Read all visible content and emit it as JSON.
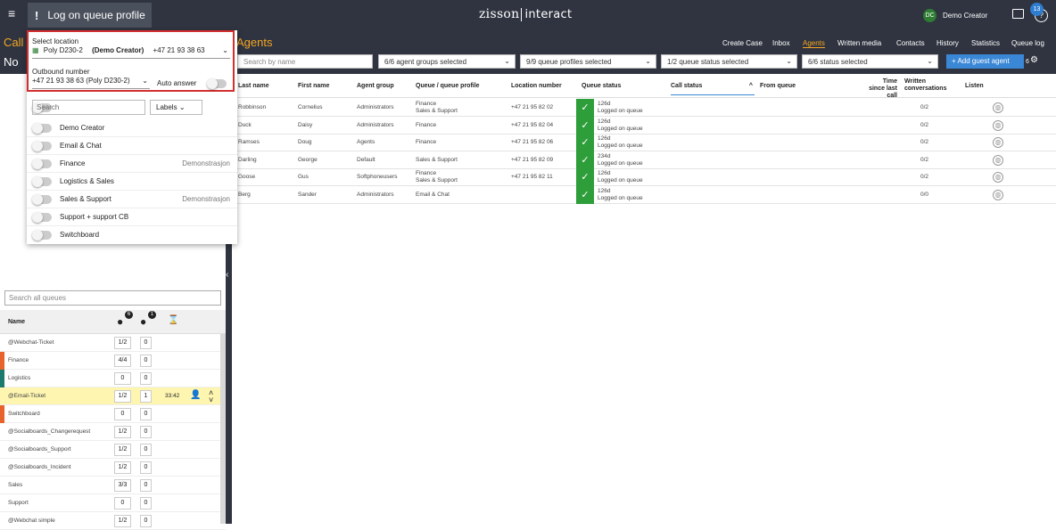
{
  "topbar": {
    "menu_icon": "hamburger-icon",
    "button_label": "Log on queue profile",
    "button_excl": "!",
    "logo_a": "zisson",
    "logo_b": "interact",
    "avatar_initials": "DC",
    "user_name": "Demo Creator",
    "badge_count": "13"
  },
  "left": {
    "title": "Call",
    "subtitle": "No"
  },
  "agents": {
    "title": "Agents",
    "nav": [
      "Create Case",
      "Inbox",
      "Agents",
      "Written media",
      "Contacts",
      "History",
      "Statistics",
      "Queue log"
    ],
    "filters": {
      "search_placeholder": "Search by name",
      "groups": "6/6 agent groups selected",
      "profiles": "9/9 queue profiles selected",
      "queue_status": "1/2 queue status selected",
      "status": "6/6 status selected"
    },
    "add_guest": "Add guest agent",
    "count": "6"
  },
  "table": {
    "headers": [
      "Last name",
      "First name",
      "Agent group",
      "Queue / queue profile",
      "Location number",
      "Queue status",
      "Call status",
      "From queue",
      "Time since last call",
      "Written conversations",
      "Listen"
    ],
    "rows": [
      {
        "last": "Robbinson",
        "first": "Cornelius",
        "group": "Administrators",
        "queue": [
          "Finance",
          "Sales & Support"
        ],
        "location": "+47 21 95 82 02",
        "time": "126d",
        "status": "Logged on queue",
        "written": "0/2"
      },
      {
        "last": "Duck",
        "first": "Daisy",
        "group": "Administrators",
        "queue": [
          "Finance"
        ],
        "location": "+47 21 95 82 04",
        "time": "126d",
        "status": "Logged on queue",
        "written": "0/2"
      },
      {
        "last": "Ramses",
        "first": "Doug",
        "group": "Agents",
        "queue": [
          "Finance"
        ],
        "location": "+47 21 95 82 06",
        "time": "126d",
        "status": "Logged on queue",
        "written": "0/2"
      },
      {
        "last": "Darling",
        "first": "George",
        "group": "Default",
        "queue": [
          "Sales & Support"
        ],
        "location": "+47 21 95 82 09",
        "time": "234d",
        "status": "Logged on queue",
        "written": "0/2"
      },
      {
        "last": "Goose",
        "first": "Gus",
        "group": "Softphoneusers",
        "queue": [
          "Finance",
          "Sales & Support"
        ],
        "location": "+47 21 95 82 11",
        "time": "126d",
        "status": "Logged on queue",
        "written": "0/2"
      },
      {
        "last": "Berg",
        "first": "Sander",
        "group": "Administrators",
        "queue": [
          "Email & Chat"
        ],
        "location": "",
        "time": "126d",
        "status": "Logged on queue",
        "written": "0/0"
      }
    ]
  },
  "popup": {
    "location_label": "Select location",
    "location_name": "Poly D230-2",
    "location_user": "(Demo Creator)",
    "location_number": "+47 21 93 38 63",
    "outbound_label": "Outbound number",
    "outbound_value": "+47 21 93 38 63 (Poly D230-2)",
    "auto_answer": "Auto answer",
    "search_placeholder": "Search",
    "labels": "Labels",
    "profiles": [
      {
        "name": "Demo Creator",
        "tag": ""
      },
      {
        "name": "Email & Chat",
        "tag": ""
      },
      {
        "name": "Finance",
        "tag": "Demonstrasjon"
      },
      {
        "name": "Logistics & Sales",
        "tag": ""
      },
      {
        "name": "Sales & Support",
        "tag": "Demonstrasjon"
      },
      {
        "name": "Support + support CB",
        "tag": ""
      },
      {
        "name": "Switchboard",
        "tag": ""
      }
    ]
  },
  "queues": {
    "search_placeholder": "Search all queues",
    "name_header": "Name",
    "agents_badge": "6",
    "callers_badge": "1",
    "rows": [
      {
        "name": "@Webchat-Ticket",
        "a": "1/2",
        "b": "0",
        "color": "",
        "extra": ""
      },
      {
        "name": "Finance",
        "a": "4/4",
        "b": "0",
        "color": "#e8632b",
        "extra": ""
      },
      {
        "name": "Logistics",
        "a": "0",
        "b": "0",
        "color": "#1a7a6e",
        "extra": ""
      },
      {
        "name": "@Email-Ticket",
        "a": "1/2",
        "b": "1",
        "color": "",
        "extra": "33:42",
        "highlight": true
      },
      {
        "name": "Switchboard",
        "a": "0",
        "b": "0",
        "color": "#e8632b",
        "extra": ""
      },
      {
        "name": "@Socialboards_Changerequest",
        "a": "1/2",
        "b": "0",
        "color": "",
        "extra": ""
      },
      {
        "name": "@Socialboards_Support",
        "a": "1/2",
        "b": "0",
        "color": "",
        "extra": ""
      },
      {
        "name": "@Socialboards_Incident",
        "a": "1/2",
        "b": "0",
        "color": "",
        "extra": ""
      },
      {
        "name": "Sales",
        "a": "3/3",
        "b": "0",
        "color": "",
        "extra": ""
      },
      {
        "name": "Support",
        "a": "0",
        "b": "0",
        "color": "",
        "extra": ""
      },
      {
        "name": "@Webchat simple",
        "a": "1/2",
        "b": "0",
        "color": "",
        "extra": ""
      }
    ]
  }
}
